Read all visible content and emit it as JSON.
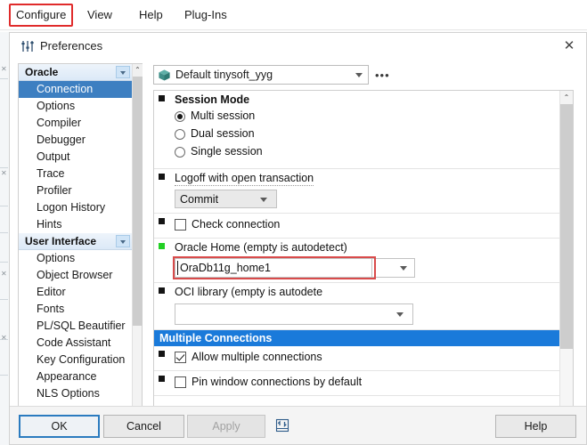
{
  "menubar": {
    "items": [
      {
        "label": "Configure",
        "highlighted": true
      },
      {
        "label": "View",
        "highlighted": false
      },
      {
        "label": "Help",
        "highlighted": false
      },
      {
        "label": "Plug-Ins",
        "highlighted": false
      }
    ],
    "highlight_color": "#e02b2b"
  },
  "dialog": {
    "title": "Preferences",
    "close_label": "✕"
  },
  "sidebar": {
    "groups": [
      {
        "label": "Oracle",
        "items": [
          {
            "label": "Connection",
            "selected": true
          },
          {
            "label": "Options",
            "selected": false
          },
          {
            "label": "Compiler",
            "selected": false
          },
          {
            "label": "Debugger",
            "selected": false
          },
          {
            "label": "Output",
            "selected": false
          },
          {
            "label": "Trace",
            "selected": false
          },
          {
            "label": "Profiler",
            "selected": false
          },
          {
            "label": "Logon History",
            "selected": false
          },
          {
            "label": "Hints",
            "selected": false
          }
        ]
      },
      {
        "label": "User Interface",
        "items": [
          {
            "label": "Options",
            "selected": false
          },
          {
            "label": "Object Browser",
            "selected": false
          },
          {
            "label": "Editor",
            "selected": false
          },
          {
            "label": "Fonts",
            "selected": false
          },
          {
            "label": "PL/SQL Beautifier",
            "selected": false
          },
          {
            "label": "Code Assistant",
            "selected": false
          },
          {
            "label": "Key Configuration",
            "selected": false
          },
          {
            "label": "Appearance",
            "selected": false
          },
          {
            "label": "NLS Options",
            "selected": false
          }
        ]
      }
    ],
    "scroll_up": "⌃",
    "scroll_down": "⌄",
    "selected_bg": "#3d7fc1"
  },
  "profile": {
    "value": "Default tinysoft_yyg",
    "icon": "package-icon",
    "more_label": "•••"
  },
  "main": {
    "session_mode": {
      "title": "Session Mode",
      "options": [
        {
          "label": "Multi session",
          "selected": true
        },
        {
          "label": "Dual session",
          "selected": false
        },
        {
          "label": "Single session",
          "selected": false
        }
      ]
    },
    "logoff": {
      "title": "Logoff with open transaction",
      "value": "Commit"
    },
    "check_connection": {
      "label": "Check connection",
      "checked": false
    },
    "oracle_home": {
      "title": "Oracle Home (empty is autodetect)",
      "value": "OraDb11g_home1",
      "highlight_color": "#d94b4b",
      "marker_color": "#22d024"
    },
    "oci_library": {
      "title": "OCI library (empty is autodete",
      "value": ""
    },
    "multiple_connections": {
      "section_title": "Multiple Connections",
      "section_color": "#1a7ada",
      "allow": {
        "label": "Allow multiple connections",
        "checked": true
      },
      "pin": {
        "label": "Pin window connections by default",
        "checked": false
      }
    },
    "scroll_up": "⌃",
    "scroll_down": "⌄"
  },
  "footer": {
    "ok": "OK",
    "cancel": "Cancel",
    "apply": "Apply",
    "help": "Help",
    "import_export_icon": "import-export-icon"
  }
}
